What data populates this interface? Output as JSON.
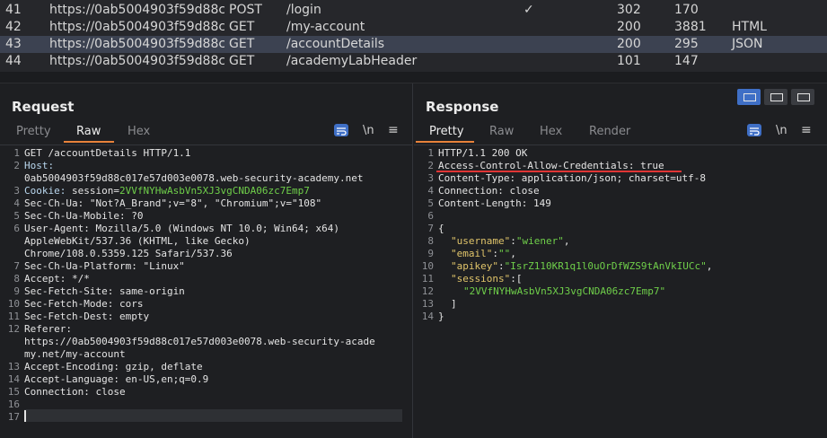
{
  "history": {
    "rows": [
      {
        "id": "41",
        "url": "https://0ab5004903f59d88c...",
        "method": "POST",
        "path": "/login",
        "check": "✓",
        "status": "302",
        "length": "170",
        "mime": ""
      },
      {
        "id": "42",
        "url": "https://0ab5004903f59d88c...",
        "method": "GET",
        "path": "/my-account",
        "check": "",
        "status": "200",
        "length": "3881",
        "mime": "HTML"
      },
      {
        "id": "43",
        "url": "https://0ab5004903f59d88c...",
        "method": "GET",
        "path": "/accountDetails",
        "check": "",
        "status": "200",
        "length": "295",
        "mime": "JSON"
      },
      {
        "id": "44",
        "url": "https://0ab5004903f59d88c...",
        "method": "GET",
        "path": "/academyLabHeader",
        "check": "",
        "status": "101",
        "length": "147",
        "mime": ""
      }
    ]
  },
  "request": {
    "title": "Request",
    "tabs": [
      "Pretty",
      "Raw",
      "Hex"
    ],
    "active_tab": "Raw",
    "wrap_icon": "wrap-icon",
    "newline_label": "\\n",
    "menu_icon": "menu-icon"
  },
  "response": {
    "title": "Response",
    "tabs": [
      "Pretty",
      "Raw",
      "Hex",
      "Render"
    ],
    "active_tab": "Pretty",
    "newline_label": "\\n"
  },
  "req_lines": {
    "l1": "GET /accountDetails HTTP/1.1",
    "l2a": "Host:",
    "l2b": "0ab5004903f59d88c017e57d003e0078.web-security-academy.net",
    "l3k": "Cookie:",
    "l3a": " session=",
    "l3v": "2VVfNYHwAsbVn5XJ3vgCNDA06zc7Emp7",
    "l4": "Sec-Ch-Ua: \"Not?A_Brand\";v=\"8\", \"Chromium\";v=\"108\"",
    "l5": "Sec-Ch-Ua-Mobile: ?0",
    "l6a": "User-Agent: Mozilla/5.0 (Windows NT 10.0; Win64; x64)",
    "l6b": "AppleWebKit/537.36 (KHTML, like Gecko)",
    "l6c": "Chrome/108.0.5359.125 Safari/537.36",
    "l7": "Sec-Ch-Ua-Platform: \"Linux\"",
    "l8": "Accept: */*",
    "l9": "Sec-Fetch-Site: same-origin",
    "l10": "Sec-Fetch-Mode: cors",
    "l11": "Sec-Fetch-Dest: empty",
    "l12a": "Referer:",
    "l12b": "https://0ab5004903f59d88c017e57d003e0078.web-security-acade",
    "l12c": "my.net/my-account",
    "l13": "Accept-Encoding: gzip, deflate",
    "l14": "Accept-Language: en-US,en;q=0.9",
    "l15": "Connection: close"
  },
  "res_lines": {
    "l1": "HTTP/1.1 200 OK",
    "l2": "Access-Control-Allow-Credentials: true",
    "l3": "Content-Type: application/json; charset=utf-8",
    "l4": "Connection: close",
    "l5": "Content-Length: 149",
    "l7": "{",
    "l8k": "\"username\"",
    "l8v": "\"wiener\"",
    "l9k": "\"email\"",
    "l9v": "\"\"",
    "l10k": "\"apikey\"",
    "l10v": "\"IsrZ110KR1q1l0uOrDfWZS9tAnVkIUCc\"",
    "l11k": "\"sessions\"",
    "l11v": ":[",
    "l12": "\"2VVfNYHwAsbVn5XJ3vgCNDA06zc7Emp7\"",
    "l13": "]",
    "l14": "}"
  }
}
